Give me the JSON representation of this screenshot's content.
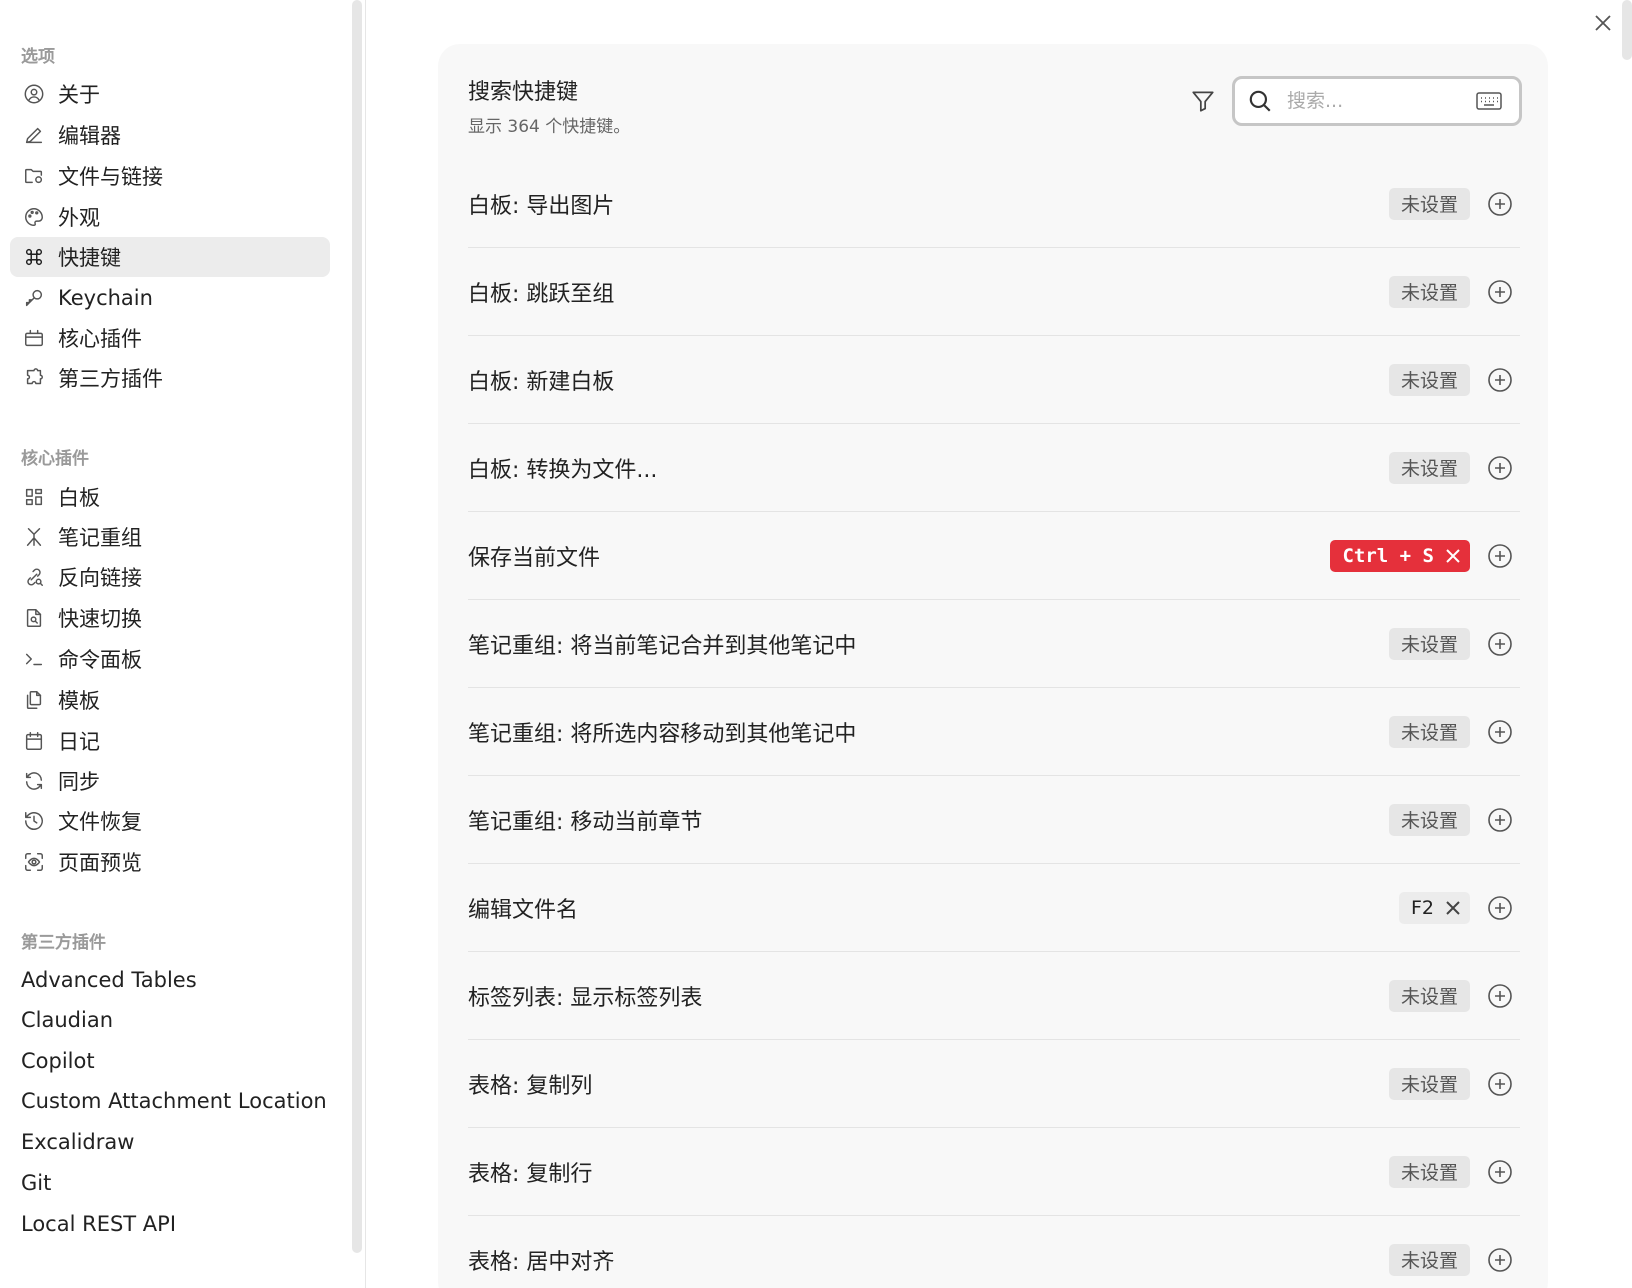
{
  "sidebar": {
    "sections": [
      {
        "title": "选项",
        "items": [
          {
            "label": "关于",
            "icon": "user-circle-icon"
          },
          {
            "label": "编辑器",
            "icon": "pencil-icon"
          },
          {
            "label": "文件与链接",
            "icon": "folder-cog-icon"
          },
          {
            "label": "外观",
            "icon": "palette-icon"
          },
          {
            "label": "快捷键",
            "icon": "command-icon",
            "active": true
          },
          {
            "label": "Keychain",
            "icon": "key-icon"
          },
          {
            "label": "核心插件",
            "icon": "plugin-box-icon"
          },
          {
            "label": "第三方插件",
            "icon": "puzzle-icon"
          }
        ]
      },
      {
        "title": "核心插件",
        "items": [
          {
            "label": "白板",
            "icon": "layout-dashboard-icon"
          },
          {
            "label": "笔记重组",
            "icon": "merge-icon"
          },
          {
            "label": "反向链接",
            "icon": "link-search-icon"
          },
          {
            "label": "快速切换",
            "icon": "file-search-icon"
          },
          {
            "label": "命令面板",
            "icon": "terminal-icon"
          },
          {
            "label": "模板",
            "icon": "files-icon"
          },
          {
            "label": "日记",
            "icon": "calendar-icon"
          },
          {
            "label": "同步",
            "icon": "refresh-icon"
          },
          {
            "label": "文件恢复",
            "icon": "history-icon"
          },
          {
            "label": "页面预览",
            "icon": "scan-eye-icon"
          }
        ]
      },
      {
        "title": "第三方插件",
        "items": [
          {
            "label": "Advanced Tables"
          },
          {
            "label": "Claudian"
          },
          {
            "label": "Copilot"
          },
          {
            "label": "Custom Attachment Location"
          },
          {
            "label": "Excalidraw"
          },
          {
            "label": "Git"
          },
          {
            "label": "Local REST API"
          }
        ]
      }
    ]
  },
  "main": {
    "title": "搜索快捷键",
    "subtitle": "显示 364 个快捷键。",
    "search": {
      "placeholder": "搜索..."
    },
    "rows": [
      {
        "label": "白板: 导出图片",
        "hotkey": "未设置",
        "state": "unset"
      },
      {
        "label": "白板: 跳跃至组",
        "hotkey": "未设置",
        "state": "unset"
      },
      {
        "label": "白板: 新建白板",
        "hotkey": "未设置",
        "state": "unset"
      },
      {
        "label": "白板: 转换为文件...",
        "hotkey": "未设置",
        "state": "unset"
      },
      {
        "label": "保存当前文件",
        "hotkey": "Ctrl + S",
        "state": "conflict"
      },
      {
        "label": "笔记重组: 将当前笔记合并到其他笔记中",
        "hotkey": "未设置",
        "state": "unset"
      },
      {
        "label": "笔记重组: 将所选内容移动到其他笔记中",
        "hotkey": "未设置",
        "state": "unset"
      },
      {
        "label": "笔记重组: 移动当前章节",
        "hotkey": "未设置",
        "state": "unset"
      },
      {
        "label": "编辑文件名",
        "hotkey": "F2",
        "state": "set"
      },
      {
        "label": "标签列表: 显示标签列表",
        "hotkey": "未设置",
        "state": "unset"
      },
      {
        "label": "表格: 复制列",
        "hotkey": "未设置",
        "state": "unset"
      },
      {
        "label": "表格: 复制行",
        "hotkey": "未设置",
        "state": "unset"
      },
      {
        "label": "表格: 居中对齐",
        "hotkey": "未设置",
        "state": "unset"
      }
    ]
  },
  "colors": {
    "conflict": "#e5303b",
    "active_bg": "#ececec",
    "panel_bg": "#f8f8f8"
  }
}
